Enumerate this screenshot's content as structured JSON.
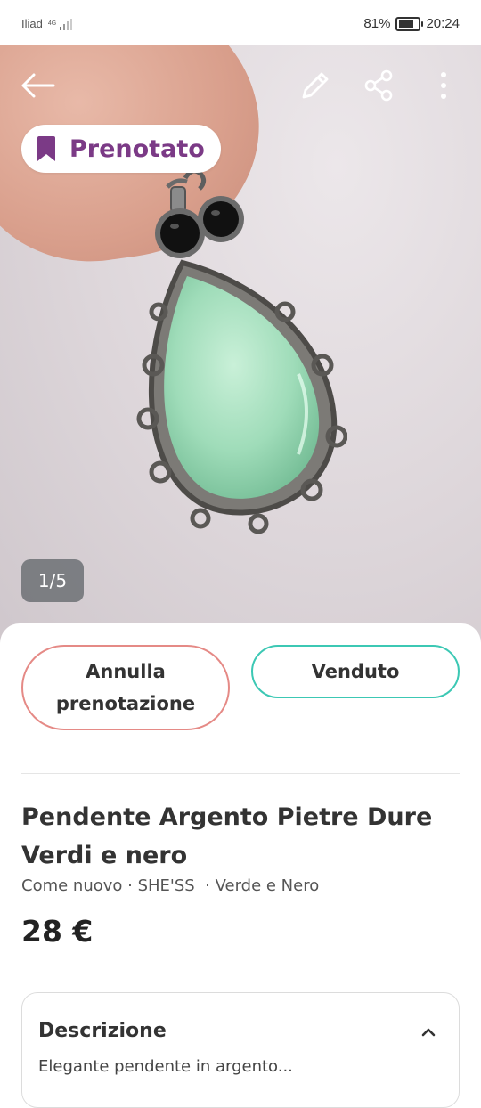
{
  "status_bar": {
    "carrier": "Iliad",
    "network": "4G",
    "battery": "81%",
    "battery_level": 0.81,
    "time": "20:24"
  },
  "toolbar": {
    "back_icon": "arrow-left-icon",
    "edit_icon": "pencil-icon",
    "share_icon": "share-icon",
    "more_icon": "more-vertical-icon"
  },
  "listing": {
    "status_chip": "Prenotato",
    "status_icon": "bookmark-icon",
    "image_counter": "1/5",
    "actions": {
      "cancel_reservation": "Annulla prenotazione",
      "mark_sold": "Venduto"
    },
    "title": "Pendente Argento Pietre Dure Verdi e nero",
    "meta": "Come nuovo · SHE'SS  · Verde e Nero",
    "price": "28 €",
    "description": {
      "heading": "Descrizione",
      "text": "Elegante pendente in argento..."
    }
  },
  "colors": {
    "accent_purple": "#7b3a86",
    "cancel_border": "#e58a86",
    "sold_border": "#3cc8b4"
  }
}
